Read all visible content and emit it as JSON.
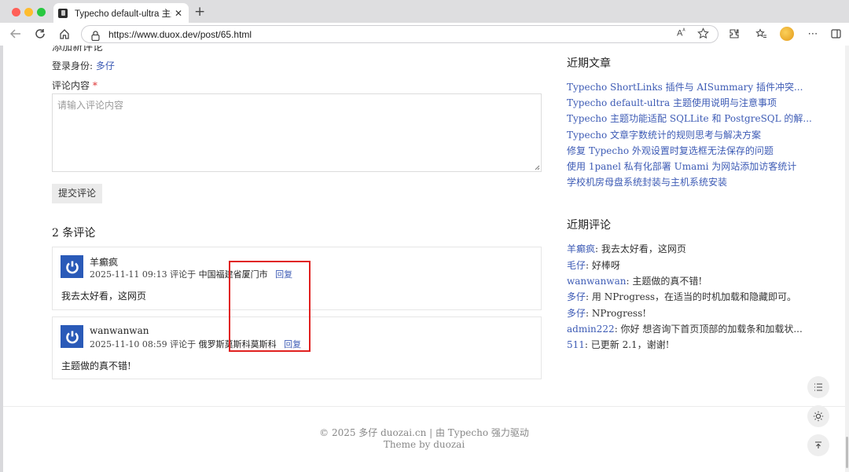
{
  "browser": {
    "tab_title": "Typecho default-ultra 主题使用说明与注意事项",
    "tab_close": "✕",
    "new_tab": "+",
    "url": "https://www.duox.dev/post/65.html"
  },
  "comment_form": {
    "heading": "添加新评论",
    "login_label": "登录身份: ",
    "login_user": "多仔",
    "content_label": "评论内容",
    "required_mark": "*",
    "placeholder": "请输入评论内容",
    "submit_label": "提交评论"
  },
  "comments": {
    "count_label": "2 条评论",
    "items": [
      {
        "author": "羊癫疯",
        "date": "2025-11-11 09:13",
        "from_label": "评论于",
        "location": "中国福建省厦门市",
        "reply_label": "回复",
        "body": "我去太好看，这网页"
      },
      {
        "author": "wanwanwan",
        "date": "2025-11-10 08:59",
        "from_label": "评论于",
        "location": "俄罗斯莫斯科莫斯科",
        "reply_label": "回复",
        "body": "主题做的真不错!"
      }
    ]
  },
  "sidebar": {
    "recent_posts_title": "近期文章",
    "recent_posts": [
      "Typecho ShortLinks 插件与 AISummary 插件冲突...",
      "Typecho default-ultra 主题使用说明与注意事项",
      "Typecho 主题功能适配 SQLLite 和 PostgreSQL 的解...",
      "Typecho 文章字数统计的规则思考与解决方案",
      "修复 Typecho 外观设置时复选框无法保存的问题",
      "使用 1panel 私有化部署 Umami 为网站添加访客统计",
      "学校机房母盘系统封装与主机系统安装"
    ],
    "recent_comments_title": "近期评论",
    "recent_comments": [
      {
        "who": "羊癫疯",
        "text": ": 我去太好看，这网页"
      },
      {
        "who": "毛仔",
        "text": ": 好棒呀"
      },
      {
        "who": "wanwanwan",
        "text": ": 主题做的真不错!"
      },
      {
        "who": "多仔",
        "text": ": 用 NProgress，在适当的时机加载和隐藏即可。"
      },
      {
        "who": "多仔",
        "text": ": NProgress!"
      },
      {
        "who": "admin222",
        "text": ": 你好 想咨询下首页顶部的加载条和加载状..."
      },
      {
        "who": "511",
        "text": ": 已更新 2.1，谢谢!"
      }
    ]
  },
  "footer": {
    "line1": "© 2025 多仔 duozai.cn | 由 Typecho 强力驱动",
    "line2": "Theme by duozai"
  },
  "colors": {
    "link": "#3d5bb5",
    "avatar": "#2a5ab8",
    "highlight_box": "#e0201f"
  }
}
